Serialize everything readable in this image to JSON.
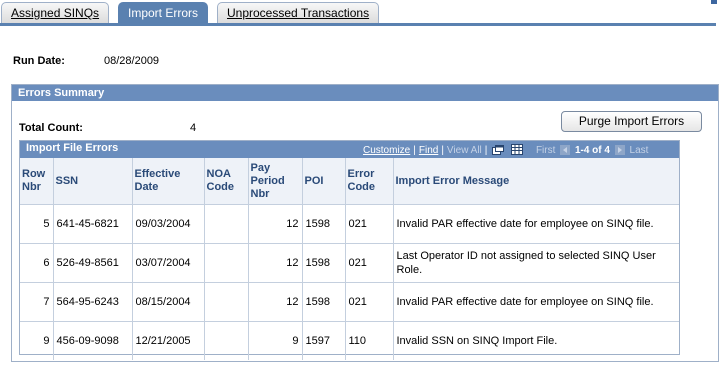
{
  "tabs": [
    {
      "label": "Assigned SINQs"
    },
    {
      "label": "Import Errors"
    },
    {
      "label": "Unprocessed Transactions"
    }
  ],
  "run_date": {
    "label": "Run Date:",
    "value": "08/28/2009"
  },
  "summary": {
    "title": "Errors Summary",
    "total_label": "Total Count:",
    "total_value": "4",
    "purge_button": "Purge Import Errors"
  },
  "grid": {
    "title": "Import File Errors",
    "nav": {
      "customize": "Customize",
      "find": "Find",
      "view_all": "View All",
      "first": "First",
      "range": "1-4 of 4",
      "last": "Last"
    },
    "columns": [
      "Row Nbr",
      "SSN",
      "Effective Date",
      "NOA Code",
      "Pay Period Nbr",
      "POI",
      "Error Code",
      "Import Error Message"
    ],
    "rows": [
      {
        "row_nbr": "5",
        "ssn": "641-45-6821",
        "effective_date": "09/03/2004",
        "noa_code": "",
        "pay_period": "12",
        "poi": "1598",
        "error_code": "021",
        "message": "Invalid PAR effective date for employee on SINQ file."
      },
      {
        "row_nbr": "6",
        "ssn": "526-49-8561",
        "effective_date": "03/07/2004",
        "noa_code": "",
        "pay_period": "12",
        "poi": "1598",
        "error_code": "021",
        "message": "Last Operator ID not assigned to selected SINQ User Role."
      },
      {
        "row_nbr": "7",
        "ssn": "564-95-6243",
        "effective_date": "08/15/2004",
        "noa_code": "",
        "pay_period": "12",
        "poi": "1598",
        "error_code": "021",
        "message": "Invalid PAR effective date for employee on SINQ file."
      },
      {
        "row_nbr": "9",
        "ssn": "456-09-9098",
        "effective_date": "12/21/2005",
        "noa_code": "",
        "pay_period": "9",
        "poi": "1597",
        "error_code": "110",
        "message": "Invalid SSN on SINQ Import File."
      }
    ]
  },
  "colors": {
    "header_blue": "#6a8dbd",
    "tab_active": "#5a81b0",
    "column_header_text": "#2a4a78"
  },
  "icons": [
    "new-window-icon",
    "download-grid-icon",
    "first-arrow-icon",
    "next-arrow-icon"
  ]
}
